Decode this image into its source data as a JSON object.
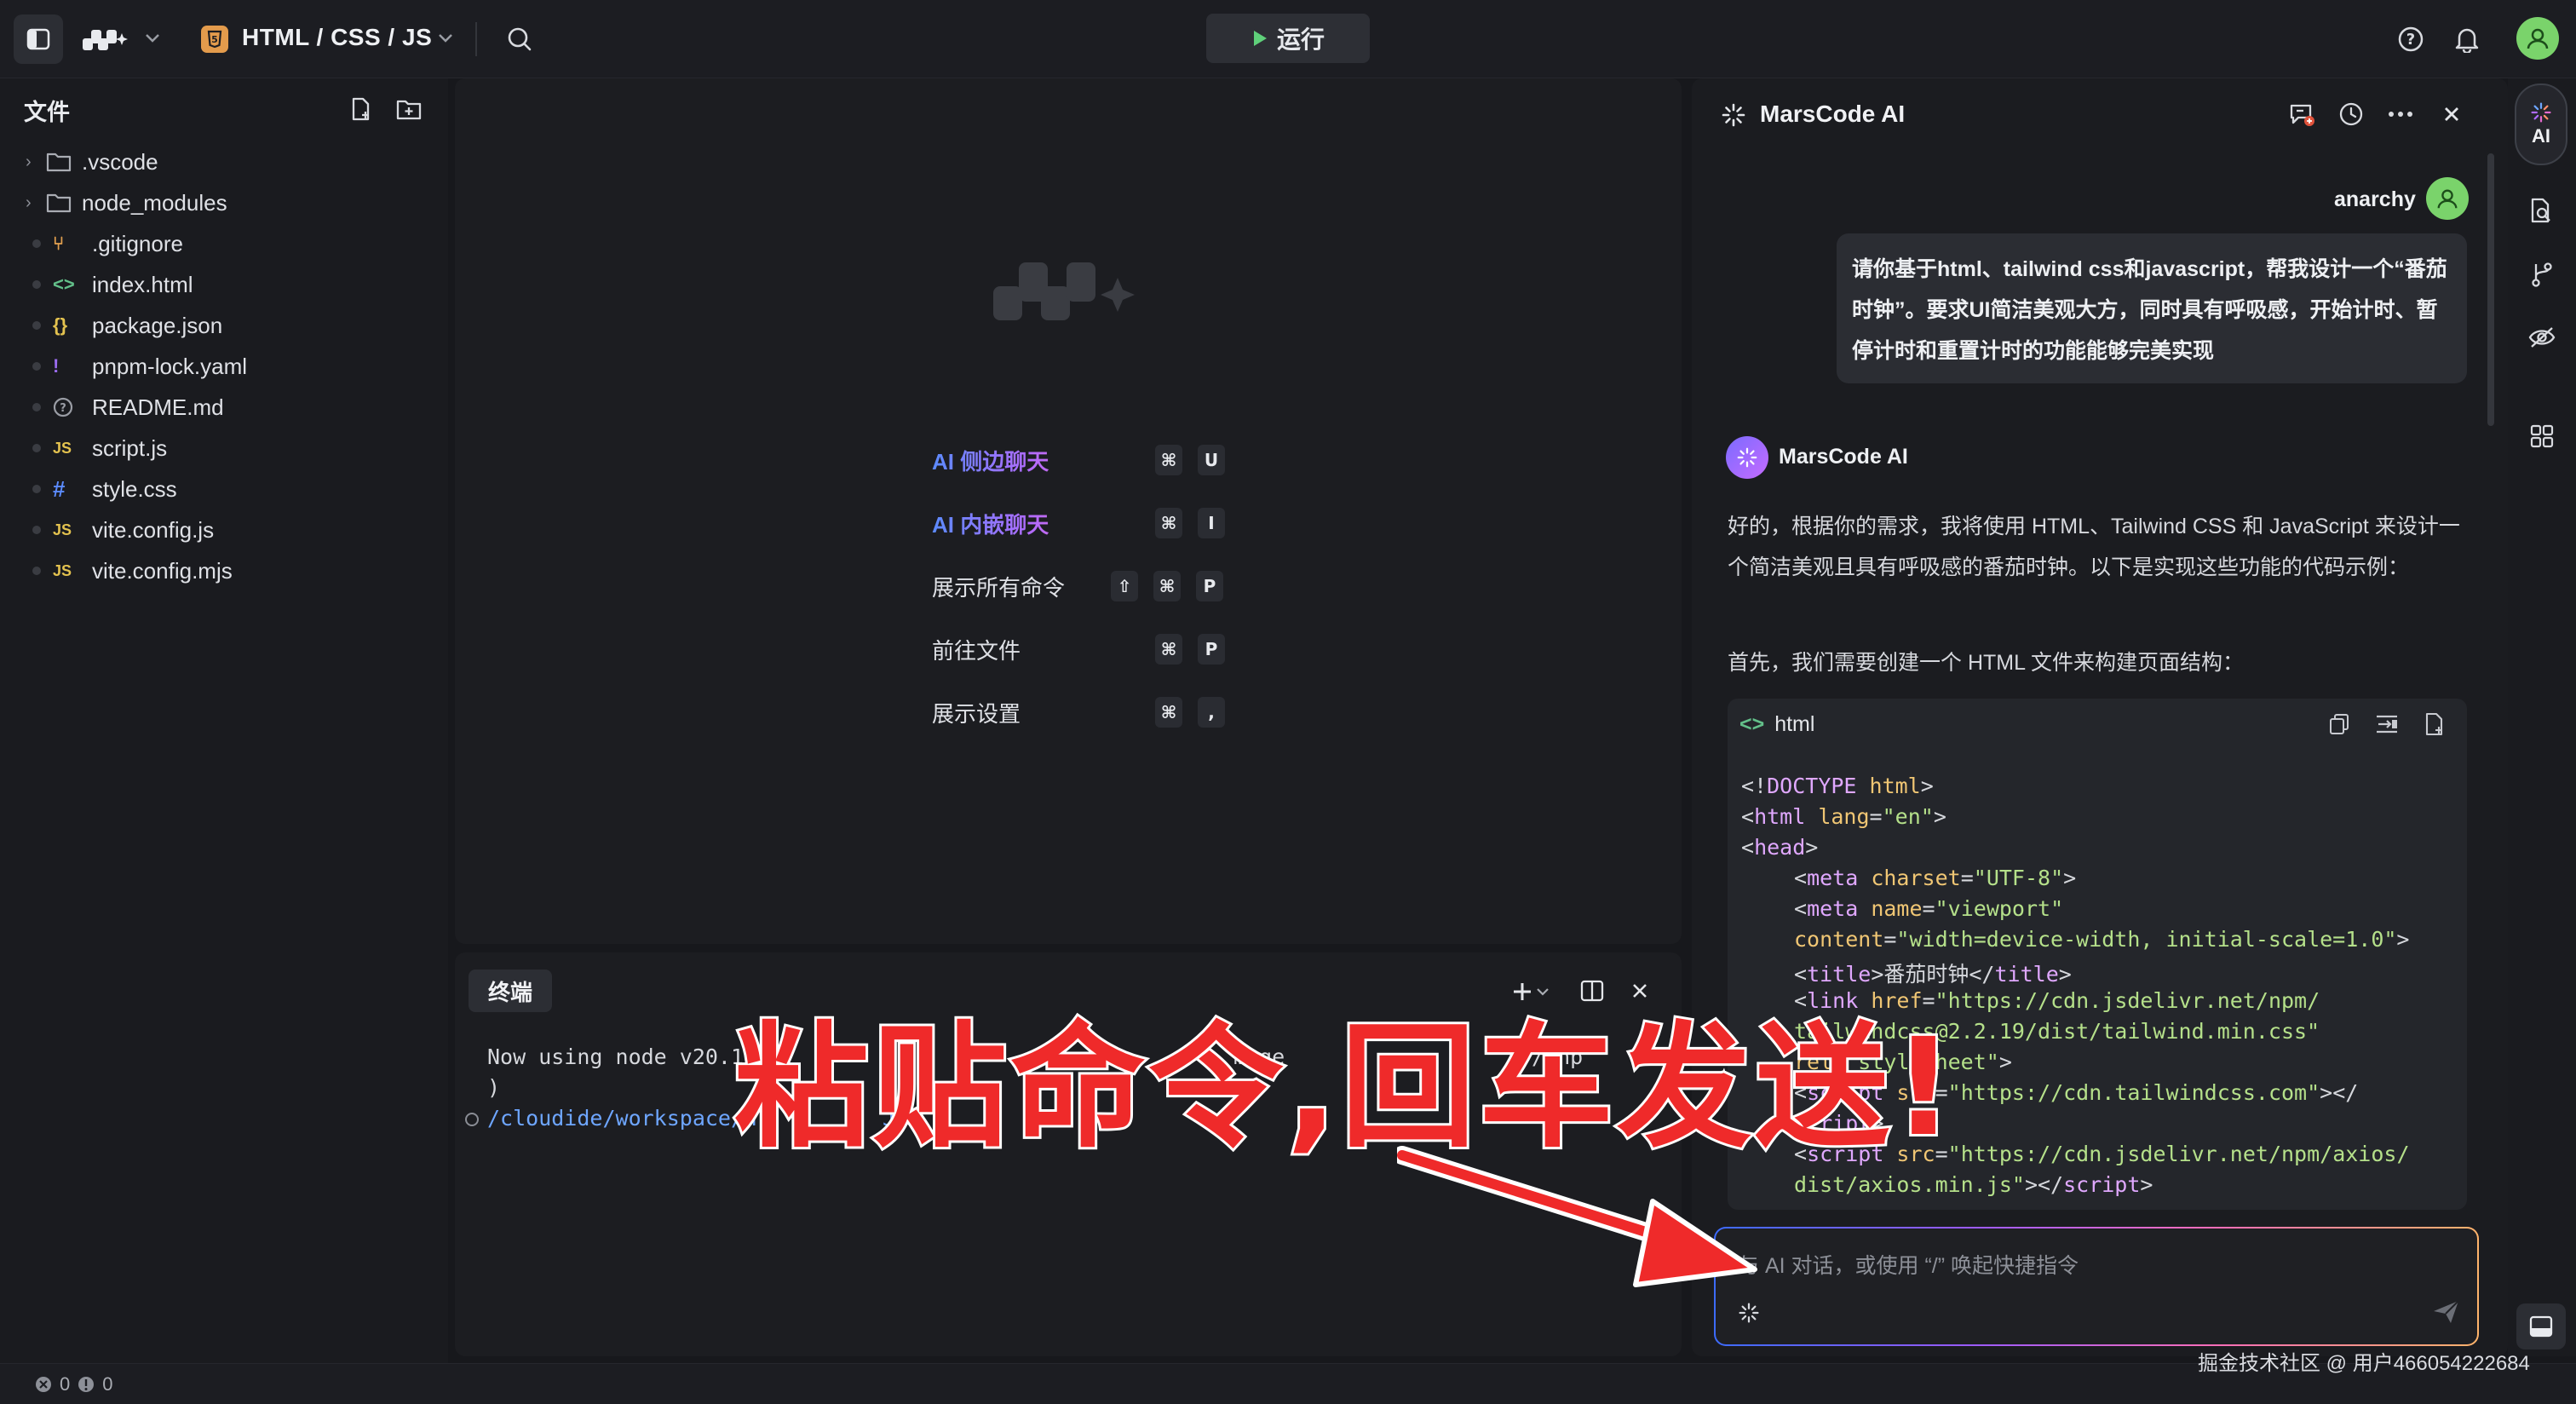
{
  "topbar": {
    "project_name": "HTML / CSS / JS",
    "run_label": "运行"
  },
  "explorer": {
    "title": "文件",
    "items": [
      {
        "name": ".vscode",
        "type": "folder"
      },
      {
        "name": "node_modules",
        "type": "folder"
      },
      {
        "name": ".gitignore",
        "type": "git",
        "icon": "⑂"
      },
      {
        "name": "index.html",
        "type": "html",
        "icon": "<>"
      },
      {
        "name": "package.json",
        "type": "json",
        "icon": "{}"
      },
      {
        "name": "pnpm-lock.yaml",
        "type": "yaml",
        "icon": "!"
      },
      {
        "name": "README.md",
        "type": "md",
        "icon": "?"
      },
      {
        "name": "script.js",
        "type": "js",
        "icon": "JS"
      },
      {
        "name": "style.css",
        "type": "css",
        "icon": "#"
      },
      {
        "name": "vite.config.js",
        "type": "js",
        "icon": "JS"
      },
      {
        "name": "vite.config.mjs",
        "type": "js",
        "icon": "JS"
      }
    ]
  },
  "welcome": {
    "shortcuts": [
      {
        "label": "AI 侧边聊天",
        "keys": [
          "⌘",
          "U"
        ],
        "ai": true
      },
      {
        "label": "AI 内嵌聊天",
        "keys": [
          "⌘",
          "I"
        ],
        "ai": true
      },
      {
        "label": "展示所有命令",
        "keys": [
          "⇧",
          "⌘",
          "P"
        ],
        "ai": false
      },
      {
        "label": "前往文件",
        "keys": [
          "⌘",
          "P"
        ],
        "ai": false
      },
      {
        "label": "展示设置",
        "keys": [
          "⌘",
          ","
        ],
        "ai": false
      }
    ]
  },
  "terminal": {
    "tab_label": "终端",
    "line1": "Now using node v20.1",
    "line1_tail": "mage",
    "line1_tail2": "/pnp",
    "line2": ")",
    "line3": "/cloudide/workspace/H",
    "line3_tail": "JS"
  },
  "ai_panel": {
    "title": "MarsCode AI",
    "user_name": "anarchy",
    "user_message": "请你基于html、tailwind css和javascript，帮我设计一个“番茄时钟”。要求UI简洁美观大方，同时具有呼吸感，开始计时、暂停计时和重置计时的功能能够完美实现",
    "assistant_name": "MarsCode AI",
    "reply_p1": "好的，根据你的需求，我将使用 HTML、Tailwind CSS 和 JavaScript 来设计一个简洁美观且具有呼吸感的番茄时钟。以下是实现这些功能的代码示例：",
    "reply_p2": "首先，我们需要创建一个 HTML 文件来构建页面结构：",
    "code_lang": "html",
    "code": {
      "l1_a": "<!",
      "l1_b": "DOCTYPE",
      "l1_c": " html",
      "l1_d": ">",
      "l2_a": "<",
      "l2_b": "html",
      "l2_c": " lang",
      "l2_d": "=",
      "l2_e": "\"en\"",
      "l2_f": ">",
      "l3_a": "<",
      "l3_b": "head",
      "l3_c": ">",
      "l4_a": "<",
      "l4_b": "meta",
      "l4_c": " charset",
      "l4_d": "=",
      "l4_e": "\"UTF-8\"",
      "l4_f": ">",
      "l5_a": "<",
      "l5_b": "meta",
      "l5_c": " name",
      "l5_d": "=",
      "l5_e": "\"viewport\"",
      "l6_a": "content",
      "l6_b": "=",
      "l6_c": "\"width=device-width, initial-scale=1.0\"",
      "l6_d": ">",
      "l7_a": "<",
      "l7_b": "title",
      "l7_c": ">番茄时钟</",
      "l7_d": "title",
      "l7_e": ">",
      "l8_a": "<",
      "l8_b": "link",
      "l8_c": " href",
      "l8_d": "=",
      "l8_e": "\"https://cdn.jsdelivr.net/npm/",
      "l9": "tailwindcss@2.2.19/dist/tailwind.min.css\"",
      "l10_a": "rel",
      "l10_b": "=",
      "l10_c": "\"stylesheet\"",
      "l10_d": ">",
      "l11_a": "<",
      "l11_b": "script",
      "l11_c": " src",
      "l11_d": "=",
      "l11_e": "\"https://cdn.tailwindcss.com\"",
      "l11_f": "></",
      "l12_a": "script",
      "l12_b": ">",
      "l13_a": "<",
      "l13_b": "script",
      "l13_c": " src",
      "l13_d": "=",
      "l13_e": "\"https://cdn.jsdelivr.net/npm/axios/",
      "l14_a": "dist/axios.min.js\"",
      "l14_b": "></",
      "l14_c": "script",
      "l14_d": ">"
    },
    "input_placeholder": "与 AI 对话，或使用 “/” 唤起快捷指令"
  },
  "rail": {
    "ai_label": "AI"
  },
  "status": {
    "errors": "0",
    "warnings": "0"
  },
  "overlay": {
    "text": "粘贴命令,回车发送!"
  },
  "watermark": "掘金技术社区 @ 用户466054222684",
  "colors": {
    "accent_blue": "#5b8bff",
    "overlay_red": "#ef2a2a",
    "avatar_green": "#7ad36b"
  }
}
